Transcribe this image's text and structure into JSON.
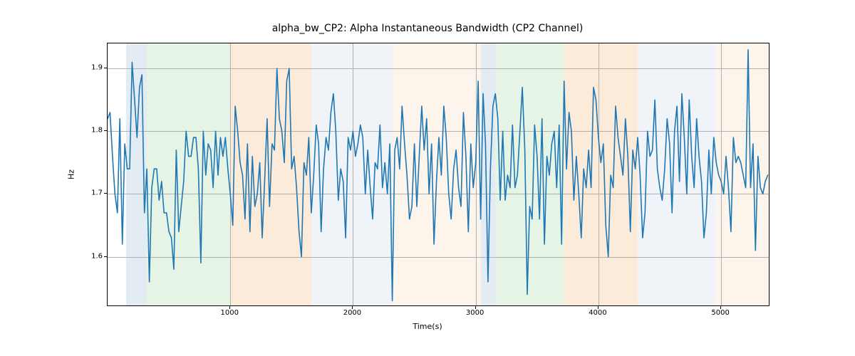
{
  "chart_data": {
    "type": "line",
    "title": "alpha_bw_CP2: Alpha Instantaneous Bandwidth (CP2 Channel)",
    "xlabel": "Time(s)",
    "ylabel": "Hz",
    "xlim": [
      0,
      5400
    ],
    "ylim": [
      1.52,
      1.94
    ],
    "xticks": [
      1000,
      2000,
      3000,
      4000,
      5000
    ],
    "yticks": [
      1.6,
      1.7,
      1.8,
      1.9
    ],
    "regions": [
      {
        "start": 150,
        "end": 320,
        "color": "#9bb8d3"
      },
      {
        "start": 320,
        "end": 1000,
        "color": "#a4d6a4"
      },
      {
        "start": 1000,
        "end": 1660,
        "color": "#f5b878"
      },
      {
        "start": 1660,
        "end": 2320,
        "color": "#c9d6e8"
      },
      {
        "start": 2320,
        "end": 3040,
        "color": "#f9dcbb"
      },
      {
        "start": 3040,
        "end": 3160,
        "color": "#9bb8d3"
      },
      {
        "start": 3160,
        "end": 3720,
        "color": "#a4d6a4"
      },
      {
        "start": 3720,
        "end": 4320,
        "color": "#f5b878"
      },
      {
        "start": 4320,
        "end": 4960,
        "color": "#c9d6e8"
      },
      {
        "start": 4960,
        "end": 5400,
        "color": "#f9dcbb"
      }
    ],
    "x": [
      0,
      20,
      40,
      60,
      80,
      100,
      120,
      140,
      160,
      180,
      200,
      220,
      240,
      260,
      280,
      300,
      320,
      340,
      360,
      380,
      400,
      420,
      440,
      460,
      480,
      500,
      520,
      540,
      560,
      580,
      600,
      620,
      640,
      660,
      680,
      700,
      720,
      740,
      760,
      780,
      800,
      820,
      840,
      860,
      880,
      900,
      920,
      940,
      960,
      980,
      1000,
      1020,
      1040,
      1060,
      1080,
      1100,
      1120,
      1140,
      1160,
      1180,
      1200,
      1220,
      1240,
      1260,
      1280,
      1300,
      1320,
      1340,
      1360,
      1380,
      1400,
      1420,
      1440,
      1460,
      1480,
      1500,
      1520,
      1540,
      1560,
      1580,
      1600,
      1620,
      1640,
      1660,
      1680,
      1700,
      1720,
      1740,
      1760,
      1780,
      1800,
      1820,
      1840,
      1860,
      1880,
      1900,
      1920,
      1940,
      1960,
      1980,
      2000,
      2020,
      2040,
      2060,
      2080,
      2100,
      2120,
      2140,
      2160,
      2180,
      2200,
      2220,
      2240,
      2260,
      2280,
      2300,
      2320,
      2340,
      2360,
      2380,
      2400,
      2420,
      2440,
      2460,
      2480,
      2500,
      2520,
      2540,
      2560,
      2580,
      2600,
      2620,
      2640,
      2660,
      2680,
      2700,
      2720,
      2740,
      2760,
      2780,
      2800,
      2820,
      2840,
      2860,
      2880,
      2900,
      2920,
      2940,
      2960,
      2980,
      3000,
      3020,
      3040,
      3060,
      3080,
      3100,
      3120,
      3140,
      3160,
      3180,
      3200,
      3220,
      3240,
      3260,
      3280,
      3300,
      3320,
      3340,
      3360,
      3380,
      3400,
      3420,
      3440,
      3460,
      3480,
      3500,
      3520,
      3540,
      3560,
      3580,
      3600,
      3620,
      3640,
      3660,
      3680,
      3700,
      3720,
      3740,
      3760,
      3780,
      3800,
      3820,
      3840,
      3860,
      3880,
      3900,
      3920,
      3940,
      3960,
      3980,
      4000,
      4020,
      4040,
      4060,
      4080,
      4100,
      4120,
      4140,
      4160,
      4180,
      4200,
      4220,
      4240,
      4260,
      4280,
      4300,
      4320,
      4340,
      4360,
      4380,
      4400,
      4420,
      4440,
      4460,
      4480,
      4500,
      4520,
      4540,
      4560,
      4580,
      4600,
      4620,
      4640,
      4660,
      4680,
      4700,
      4720,
      4740,
      4760,
      4780,
      4800,
      4820,
      4840,
      4860,
      4880,
      4900,
      4920,
      4940,
      4960,
      4980,
      5000,
      5020,
      5040,
      5060,
      5080,
      5100,
      5120,
      5140,
      5160,
      5180,
      5200,
      5220,
      5240,
      5260,
      5280,
      5300,
      5320,
      5340,
      5360,
      5380
    ],
    "values": [
      1.82,
      1.83,
      1.76,
      1.7,
      1.67,
      1.82,
      1.62,
      1.78,
      1.74,
      1.74,
      1.91,
      1.85,
      1.79,
      1.87,
      1.89,
      1.67,
      1.74,
      1.56,
      1.71,
      1.74,
      1.74,
      1.69,
      1.72,
      1.67,
      1.67,
      1.64,
      1.63,
      1.58,
      1.77,
      1.64,
      1.68,
      1.72,
      1.8,
      1.76,
      1.76,
      1.79,
      1.79,
      1.74,
      1.59,
      1.8,
      1.73,
      1.78,
      1.77,
      1.71,
      1.8,
      1.73,
      1.79,
      1.76,
      1.79,
      1.74,
      1.7,
      1.65,
      1.84,
      1.8,
      1.75,
      1.73,
      1.66,
      1.78,
      1.64,
      1.76,
      1.68,
      1.7,
      1.75,
      1.63,
      1.72,
      1.82,
      1.68,
      1.78,
      1.77,
      1.9,
      1.82,
      1.8,
      1.75,
      1.88,
      1.9,
      1.74,
      1.76,
      1.71,
      1.64,
      1.6,
      1.75,
      1.73,
      1.79,
      1.67,
      1.73,
      1.81,
      1.78,
      1.64,
      1.74,
      1.79,
      1.77,
      1.83,
      1.86,
      1.8,
      1.69,
      1.74,
      1.72,
      1.63,
      1.79,
      1.77,
      1.8,
      1.76,
      1.78,
      1.81,
      1.79,
      1.7,
      1.77,
      1.71,
      1.66,
      1.75,
      1.74,
      1.81,
      1.71,
      1.75,
      1.7,
      1.78,
      1.53,
      1.77,
      1.79,
      1.74,
      1.84,
      1.78,
      1.73,
      1.66,
      1.68,
      1.78,
      1.68,
      1.76,
      1.84,
      1.77,
      1.82,
      1.7,
      1.78,
      1.62,
      1.72,
      1.79,
      1.73,
      1.84,
      1.79,
      1.7,
      1.66,
      1.74,
      1.77,
      1.71,
      1.68,
      1.83,
      1.76,
      1.64,
      1.78,
      1.71,
      1.75,
      1.88,
      1.66,
      1.86,
      1.78,
      1.56,
      1.74,
      1.84,
      1.86,
      1.82,
      1.69,
      1.8,
      1.69,
      1.73,
      1.71,
      1.81,
      1.71,
      1.73,
      1.8,
      1.87,
      1.77,
      1.54,
      1.68,
      1.66,
      1.81,
      1.76,
      1.66,
      1.82,
      1.62,
      1.76,
      1.73,
      1.78,
      1.8,
      1.71,
      1.81,
      1.62,
      1.88,
      1.74,
      1.83,
      1.8,
      1.69,
      1.76,
      1.7,
      1.63,
      1.74,
      1.71,
      1.77,
      1.71,
      1.87,
      1.85,
      1.79,
      1.75,
      1.78,
      1.65,
      1.6,
      1.73,
      1.71,
      1.84,
      1.79,
      1.76,
      1.73,
      1.82,
      1.76,
      1.64,
      1.77,
      1.74,
      1.79,
      1.73,
      1.63,
      1.67,
      1.8,
      1.76,
      1.77,
      1.85,
      1.74,
      1.71,
      1.69,
      1.74,
      1.82,
      1.78,
      1.67,
      1.8,
      1.84,
      1.72,
      1.86,
      1.79,
      1.7,
      1.85,
      1.76,
      1.71,
      1.82,
      1.76,
      1.72,
      1.63,
      1.67,
      1.77,
      1.7,
      1.79,
      1.75,
      1.73,
      1.72,
      1.7,
      1.76,
      1.71,
      1.64,
      1.79,
      1.75,
      1.76,
      1.75,
      1.73,
      1.71,
      1.93,
      1.71,
      1.78,
      1.61,
      1.76,
      1.71,
      1.7,
      1.72,
      1.73
    ]
  }
}
